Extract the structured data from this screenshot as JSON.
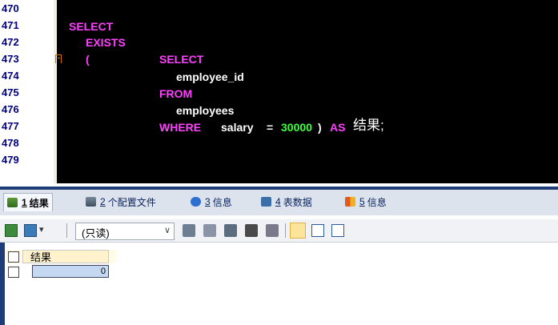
{
  "editor": {
    "line_numbers": [
      "470",
      "471",
      "472",
      "473",
      "474",
      "475",
      "476",
      "477",
      "478",
      "479"
    ],
    "code": {
      "select1": "SELECT",
      "exists": "EXISTS",
      "paren_open": "(",
      "select2": "SELECT",
      "col": "employee_id",
      "from": "FROM",
      "table": "employees",
      "where": "WHERE",
      "salary": "salary",
      "eq": "=",
      "value": "30000",
      "paren_close": ")",
      "as": "AS",
      "alias": "结果;"
    }
  },
  "tabs": [
    {
      "num": "1",
      "label": "结果"
    },
    {
      "num": "2",
      "label": "个配置文件"
    },
    {
      "num": "3",
      "label": "信息"
    },
    {
      "num": "4",
      "label": "表数据"
    },
    {
      "num": "5",
      "label": "信息"
    }
  ],
  "toolbar": {
    "mode_select": "(只读)",
    "dropdown_arrow": "∨",
    "small_arrow": "▾"
  },
  "grid": {
    "columns": [
      "结果"
    ],
    "rows": [
      [
        "0"
      ]
    ]
  }
}
